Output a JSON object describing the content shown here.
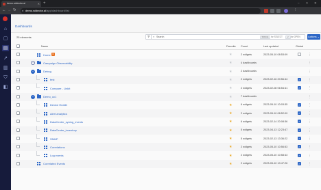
{
  "browser": {
    "tab_title": "demo.widector.ai",
    "url_host": "demo.widector.ai",
    "url_path": "/app/dashboard/list",
    "new_tab_label": "+",
    "window_controls": [
      "–",
      "□",
      "✕"
    ]
  },
  "sidebar": {
    "items": [
      {
        "icon": "home-icon",
        "glyph": "⌂"
      },
      {
        "icon": "pages-icon",
        "glyph": "▢"
      },
      {
        "icon": "dashboards-icon",
        "glyph": "▤"
      },
      {
        "icon": "analytics-icon",
        "glyph": "↗"
      },
      {
        "icon": "data-icon",
        "glyph": "▥"
      },
      {
        "icon": "security-icon",
        "glyph": "⛉"
      },
      {
        "icon": "alerts-icon",
        "glyph": "◧"
      }
    ]
  },
  "breadcrumb": "Dashboards",
  "toolbar": {
    "count_text": "25 elements",
    "search_placeholder": "Search",
    "shortcut_select_key": "SPACE",
    "shortcut_select_label": "for SELECT",
    "shortcut_open_key": "↵",
    "shortcut_open_label": "for OPEN",
    "actions_label": "Actions ⌄"
  },
  "columns": {
    "name": "Name",
    "favorite": "Favorite",
    "count": "Count",
    "last_updated": "Last updated",
    "global": "Global"
  },
  "rows": [
    {
      "depth": 0,
      "kind": "dashboard",
      "name": "Home",
      "locked": true,
      "favorite": false,
      "count": "2 widgets",
      "updated": "2023-05-10 08:53:09",
      "global": false
    },
    {
      "depth": 0,
      "kind": "folder",
      "name": "Campaign Observability",
      "favorite": false,
      "count": "4 dashboards",
      "updated": "",
      "global": false,
      "expander": "collapsed"
    },
    {
      "depth": 0,
      "kind": "folder",
      "name": "Debug",
      "favorite": false,
      "count": "2 dashboards",
      "updated": "",
      "global": false,
      "expander": "expanded"
    },
    {
      "depth": 1,
      "kind": "dashboard",
      "name": "test",
      "favorite": false,
      "count": "2 widgets",
      "updated": "2023-02-16 20:56:44",
      "global": true
    },
    {
      "depth": 1,
      "kind": "dashboard",
      "name": "Compare - Linkit",
      "favorite": false,
      "count": "2 widgets",
      "updated": "2023-02-08 06:54:41",
      "global": true
    },
    {
      "depth": 0,
      "kind": "folder",
      "name": "Demo_uc1",
      "favorite": false,
      "count": "7 dashboards",
      "updated": "",
      "global": false,
      "expander": "expanded"
    },
    {
      "depth": 1,
      "kind": "dashboard",
      "name": "Device Health",
      "favorite": true,
      "count": "6 widgets",
      "updated": "2023-05-10 10:03:35",
      "global": true
    },
    {
      "depth": 1,
      "kind": "dashboard",
      "name": "Alert analytics",
      "favorite": true,
      "count": "2 widgets",
      "updated": "2023-05-10 08:52:09",
      "global": true
    },
    {
      "depth": 1,
      "kind": "dashboard",
      "name": "DataCenter_syslog_events",
      "favorite": true,
      "count": "6 widgets",
      "updated": "2023-02-14 20:08:36",
      "global": true
    },
    {
      "depth": 1,
      "kind": "dashboard",
      "name": "DataCenter_inventory",
      "favorite": true,
      "count": "5 widgets",
      "updated": "2023-04-13 12:23:47",
      "global": true
    },
    {
      "depth": 1,
      "kind": "dashboard",
      "name": "SNMP",
      "favorite": true,
      "count": "5 widgets",
      "updated": "2023-02-13 13:36:22",
      "global": true
    },
    {
      "depth": 1,
      "kind": "dashboard",
      "name": "Correlations",
      "favorite": true,
      "count": "2 widgets",
      "updated": "2023-05-10 10:56:53",
      "global": true
    },
    {
      "depth": 1,
      "kind": "dashboard",
      "name": "Log events",
      "favorite": true,
      "count": "2 widgets",
      "updated": "2023-05-10 10:58:43",
      "global": true
    },
    {
      "depth": 0,
      "kind": "dashboard",
      "name": "Correlated Events",
      "favorite": true,
      "count": "2 widgets",
      "updated": "2023-05-10 10:47:26",
      "global": true
    }
  ],
  "colors": {
    "accent": "#2c66c6",
    "sidebar_bg": "#161b3b",
    "star": "#e9a825",
    "lock": "#e8701e"
  }
}
